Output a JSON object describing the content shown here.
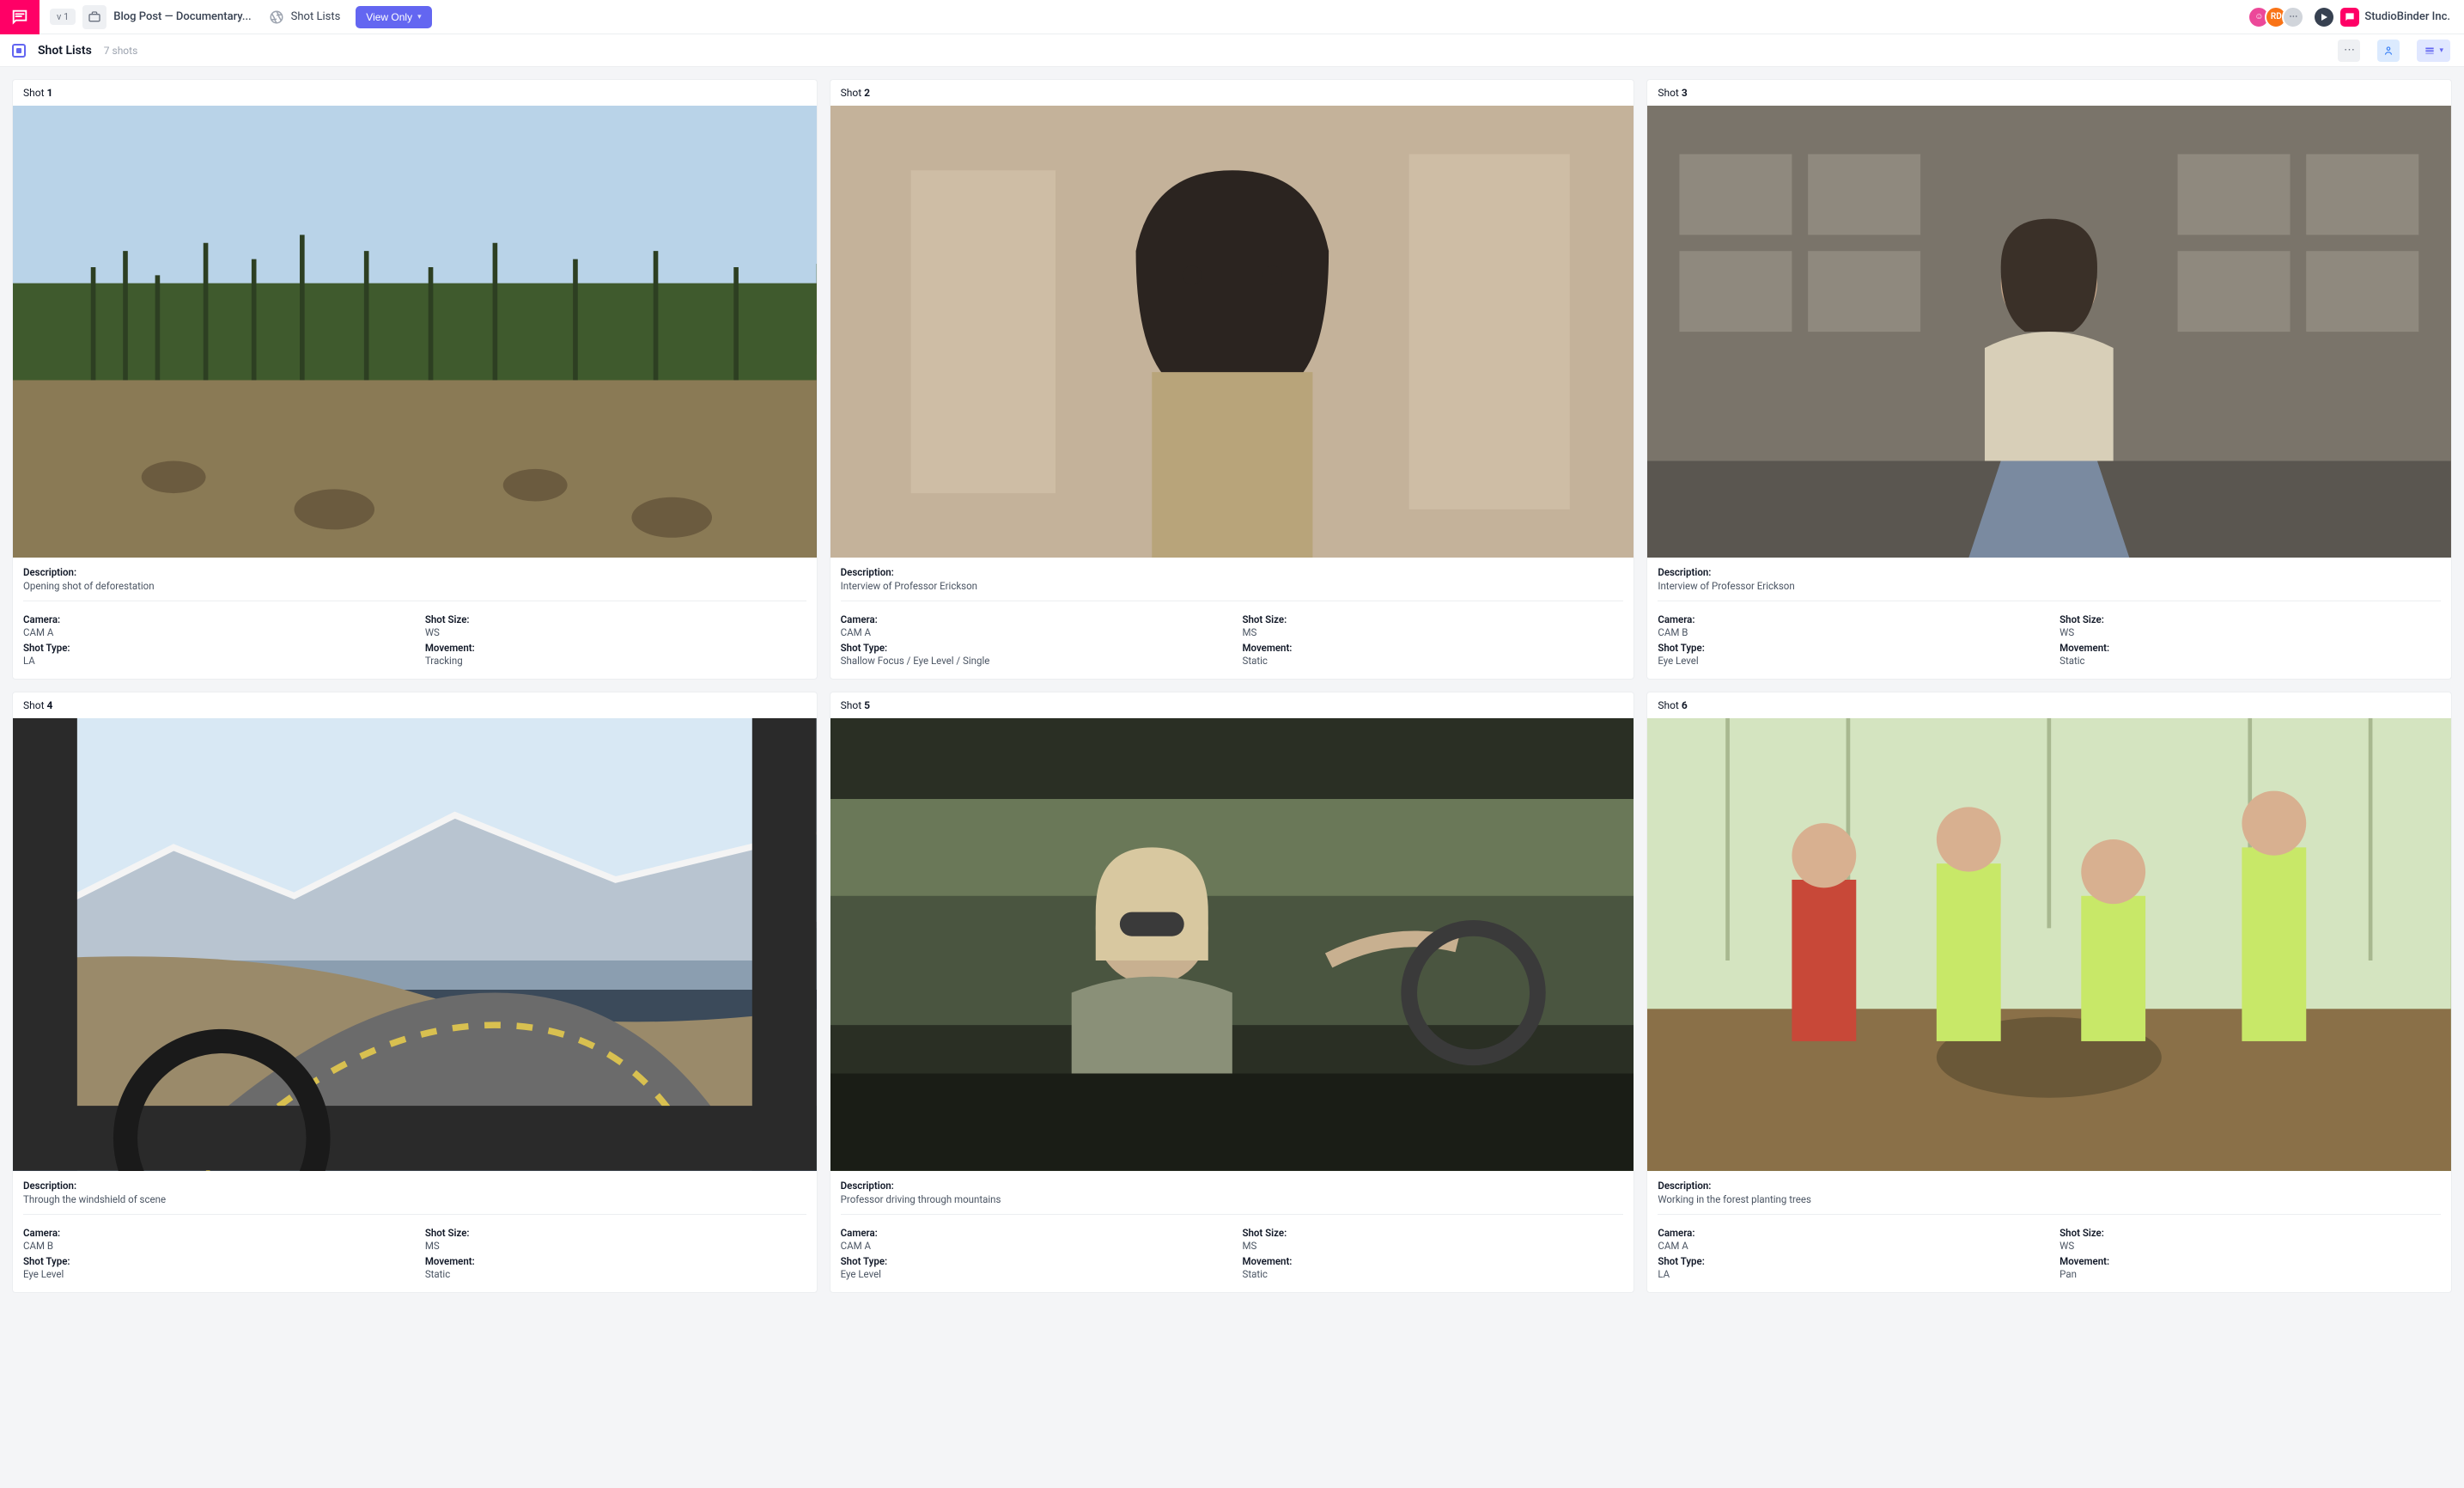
{
  "topbar": {
    "version_pill": "v 1",
    "project_title": "Blog Post — Documentary...",
    "section_label": "Shot Lists",
    "view_mode": "View Only",
    "avatars": [
      {
        "initials": "☺",
        "color": "pink"
      },
      {
        "initials": "RD",
        "color": "orange"
      },
      {
        "initials": "⋯",
        "color": "grey"
      }
    ],
    "company": "StudioBinder Inc."
  },
  "subbar": {
    "title": "Shot Lists",
    "count": "7 shots"
  },
  "labels": {
    "shot": "Shot",
    "description": "Description:",
    "camera": "Camera:",
    "shot_size": "Shot Size:",
    "shot_type": "Shot Type:",
    "movement": "Movement:"
  },
  "shots": [
    {
      "number": "1",
      "thumb_class": "t1",
      "description": "Opening shot of deforestation",
      "camera": "CAM A",
      "shot_size": "WS",
      "shot_type": "LA",
      "movement": "Tracking"
    },
    {
      "number": "2",
      "thumb_class": "t2",
      "description": "Interview of Professor Erickson",
      "camera": "CAM A",
      "shot_size": "MS",
      "shot_type": "Shallow Focus / Eye Level / Single",
      "movement": "Static"
    },
    {
      "number": "3",
      "thumb_class": "t3",
      "description": "Interview of Professor Erickson",
      "camera": "CAM B",
      "shot_size": "WS",
      "shot_type": "Eye Level",
      "movement": "Static"
    },
    {
      "number": "4",
      "thumb_class": "t4",
      "description": "Through the windshield of scene",
      "camera": "CAM B",
      "shot_size": "MS",
      "shot_type": "Eye Level",
      "movement": "Static"
    },
    {
      "number": "5",
      "thumb_class": "t5",
      "description": "Professor driving through mountains",
      "camera": "CAM A",
      "shot_size": "MS",
      "shot_type": "Eye Level",
      "movement": "Static"
    },
    {
      "number": "6",
      "thumb_class": "t6",
      "description": "Working in the forest planting trees",
      "camera": "CAM A",
      "shot_size": "WS",
      "shot_type": "LA",
      "movement": "Pan"
    }
  ]
}
